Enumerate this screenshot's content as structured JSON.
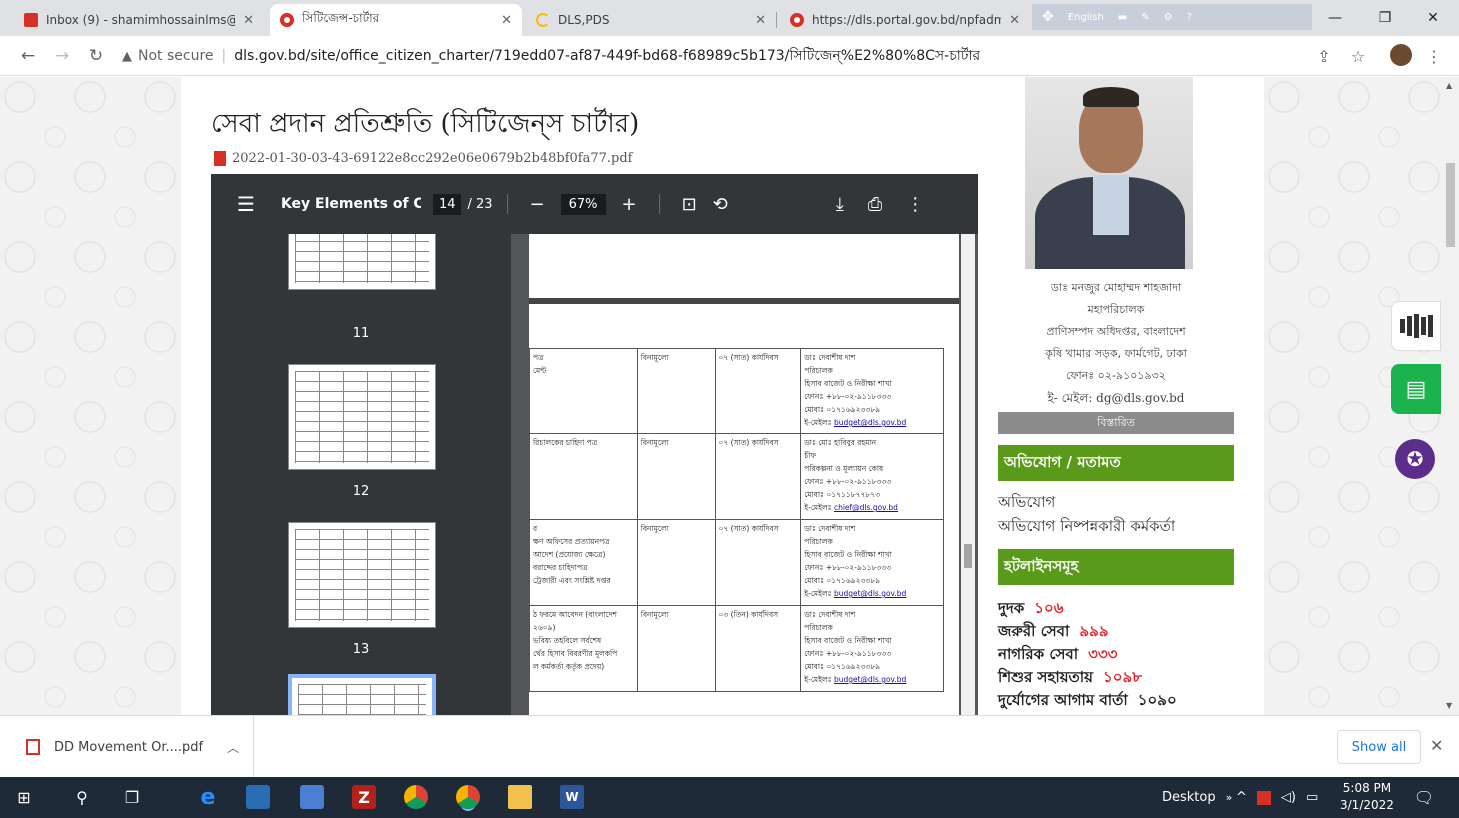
{
  "browser": {
    "tabs": [
      {
        "title": "Inbox (9) - shamimhossainlms@",
        "icon": "gmail-icon",
        "color": "#d93025",
        "active": false
      },
      {
        "title": "সিটিজেন্স-চার্টার",
        "icon": "site-favicon-icon",
        "color": "#d93025",
        "active": true
      },
      {
        "title": "DLS,PDS",
        "icon": "loading-icon",
        "color": "#fbbc04",
        "active": false
      },
      {
        "title": "https://dls.portal.gov.bd/npfadm",
        "icon": "site-favicon-icon",
        "color": "#d93025",
        "active": false
      }
    ],
    "ime_label": "English",
    "security_label": "Not secure",
    "url": "dls.gov.bd/site/office_citizen_charter/719edd07-af87-449f-bd68-f68989c5b173/সিটিজেন্%E2%80%8Cস-চার্টার"
  },
  "page": {
    "title": "সেবা প্রদান প্রতিশ্রুতি (সিটিজেন্‌স চার্টার)",
    "pdf_filename": "2022-01-30-03-43-69122e8cc292e06e0679b2b48bf0fa77.pdf"
  },
  "pdf_viewer": {
    "doc_name": "Key Elements of C...",
    "current_page": "14",
    "total_pages": "/ 23",
    "zoom": "67%",
    "thumbnails": [
      "11",
      "12",
      "13"
    ],
    "table_rows": [
      {
        "c1": "পত্র\nমেন্ট",
        "c2": "বিনামূল্যে",
        "c3": "০৭ (সাত) কার্যদিবস",
        "c4": "ডাঃ দেবাশীষ দাশ\nপরিচালক\nহিসাব বাজেট ও নিরীক্ষা শাখা\nফোনঃ +৮৮-০২-৯১১৮৩৩৩\nমোবাঃ ০১৭১৬৯২৩৩৮৯\nই-মেইলঃ",
        "link": "budget@dls.gov.bd"
      },
      {
        "c1": "রিচালকের চাহিদা পত্র",
        "c2": "বিনামূল্যে",
        "c3": "০৭ (সাত) কার্যদিবস",
        "c4": "ডাঃ মোঃ হাবিবুর রহমান\nচীফ\nপরিকল্পনা ও মূল্যায়ন কোষ\nফোনঃ +৮৮-০২-৯১১৮৩৩৩\nমোবাঃ ০১৭১১৮৭৭৮৭৩\nই-মেইলঃ",
        "link": "chief@dls.gov.bd"
      },
      {
        "c1": "র\nক্ষণ অফিসের প্রত্যায়নপত্র\nআদেশ (প্রযোজ্য ক্ষেত্রে)\nবরাদ্দের চাহিদাপত্র\nট্রেজারী এবং সংশ্লিষ্ট দপ্তর",
        "c2": "বিনামূল্যে",
        "c3": "০৭ (সাত) কার্যদিবস",
        "c4": "ডাঃ দেবাশীষ দাশ\nপরিচালক\nহিসাব বাজেট ও নিরীক্ষা শাখা\nফোনঃ +৮৮-০২-৯১১৮৩৩৩\nমোবাঃ ০১৭১৬৯২৩৩৮৯\nই-মেইলঃ",
        "link": "budget@dls.gov.bd"
      },
      {
        "c1": "ঠ ফরমে আবেদন (বাংলাদেশ\n২৬০৯)\nভবিষ্য তহবিলে সর্বশেষ\nর্থের হিসাব বিবরণীর মূলকপি\nল কর্মকর্তা কর্তৃক প্রদেয়)",
        "c2": "বিনামূল্যে",
        "c3": "০৩ (তিন) কার্যদিবস",
        "c4": "ডাঃ দেবাশীষ দাশ\nপরিচালক\nহিসাব বাজেট ও নিরীক্ষা শাখা\nফোনঃ +৮৮-০২-৯১১৮৩৩৩\nমোবাঃ ০১৭১৬৯২৩৩৮৯\nই-মেইলঃ",
        "link": "budget@dls.gov.bd"
      }
    ]
  },
  "sidebar": {
    "officer": {
      "name": "ডাঃ মনজুর মোহাম্মদ শাহজাদা",
      "designation": "মহাপরিচালক",
      "office": "প্রাণিসম্পদ অধিদপ্তর, বাংলাদেশ",
      "address": "কৃষি খামার সড়ক, ফার্মগেট, ঢাকা",
      "phone": "ফোনঃ ০২-৯১০১৯৩২",
      "email": "ই- মেইল: dg@dls.gov.bd"
    },
    "details_label": "বিস্তারিত",
    "complaint_header": "অভিযোগ / মতামত",
    "complaint_link": "অভিযোগ",
    "grievance_officer_link": "অভিযোগ নিষ্পন্নকারী কর্মকর্তা",
    "hotline_header": "হটলাইনসমূহ",
    "hotlines": [
      {
        "label": "দুদক",
        "number": "১০৬"
      },
      {
        "label": "জরুরী সেবা",
        "number": "৯৯৯"
      },
      {
        "label": "নাগরিক সেবা",
        "number": "৩৩৩"
      },
      {
        "label": "শিশুর সহায়তায়",
        "number": "১০৯৮"
      },
      {
        "label": "দুর্যোগের আগাম বার্তা",
        "number": "১০৯০"
      }
    ]
  },
  "downloads": {
    "item": "DD Movement Or....pdf",
    "show_all": "Show all"
  },
  "taskbar": {
    "desktop_label": "Desktop",
    "time": "5:08 PM",
    "date": "3/1/2022"
  },
  "colors": {
    "accent_green": "#5a9a1a",
    "hotline_red": "#e0242c",
    "chrome_tabbar": "#dfe1e5",
    "pdf_toolbar": "#323639",
    "taskbar": "#1f2a38"
  }
}
